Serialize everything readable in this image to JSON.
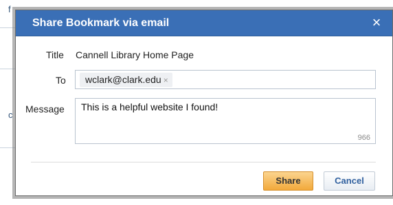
{
  "dialog": {
    "title": "Share Bookmark via email",
    "close_glyph": "×"
  },
  "form": {
    "title_label": "Title",
    "title_value": "Cannell Library Home Page",
    "to_label": "To",
    "to_tokens": [
      {
        "text": "wclark@clark.edu",
        "remove_glyph": "×"
      }
    ],
    "message_label": "Message",
    "message_value": "This is a helpful website I found!",
    "char_count": "966"
  },
  "actions": {
    "share_label": "Share",
    "cancel_label": "Cancel"
  },
  "background": {
    "fragment_a": "f",
    "fragment_b": "c"
  },
  "colors": {
    "titlebar": "#3a6fb6",
    "share_button": "#f2a93b",
    "cancel_text": "#2f5f9e",
    "overlay": "#7a7a7a"
  },
  "icons": {
    "close": "close-icon",
    "token_remove": "remove-token-icon"
  }
}
